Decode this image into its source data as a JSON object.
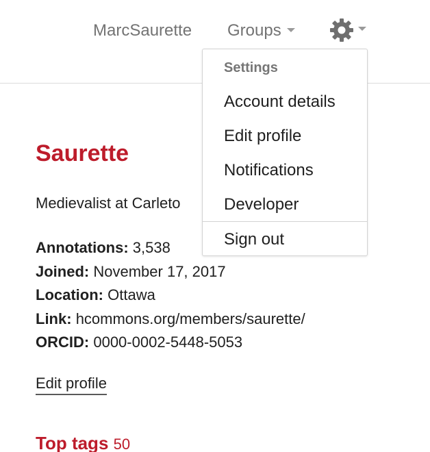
{
  "nav": {
    "user_link": "MarcSaurette",
    "groups_label": "Groups",
    "settings_menu": {
      "heading": "Settings",
      "items": [
        "Account details",
        "Edit profile",
        "Notifications",
        "Developer"
      ],
      "sign_out": "Sign out"
    }
  },
  "profile": {
    "name": "Saurette",
    "description": "Medievalist at Carleto",
    "stats": [
      {
        "label": "Annotations:",
        "value": "3,538"
      },
      {
        "label": "Joined:",
        "value": "November 17, 2017"
      },
      {
        "label": "Location:",
        "value": "Ottawa"
      },
      {
        "label": "Link:",
        "value": "hcommons.org/members/saurette/"
      },
      {
        "label": "ORCID:",
        "value": "0000-0002-5448-5053"
      }
    ],
    "edit_link": "Edit profile"
  },
  "top_tags": {
    "title": "Top tags",
    "count": "50"
  },
  "colors": {
    "brand_red": "#bd1c2b",
    "nav_gray": "#737373",
    "border": "#d3d3d3"
  },
  "icons": {
    "settings": "gear-icon",
    "menu_caret": "caret-down-icon"
  }
}
